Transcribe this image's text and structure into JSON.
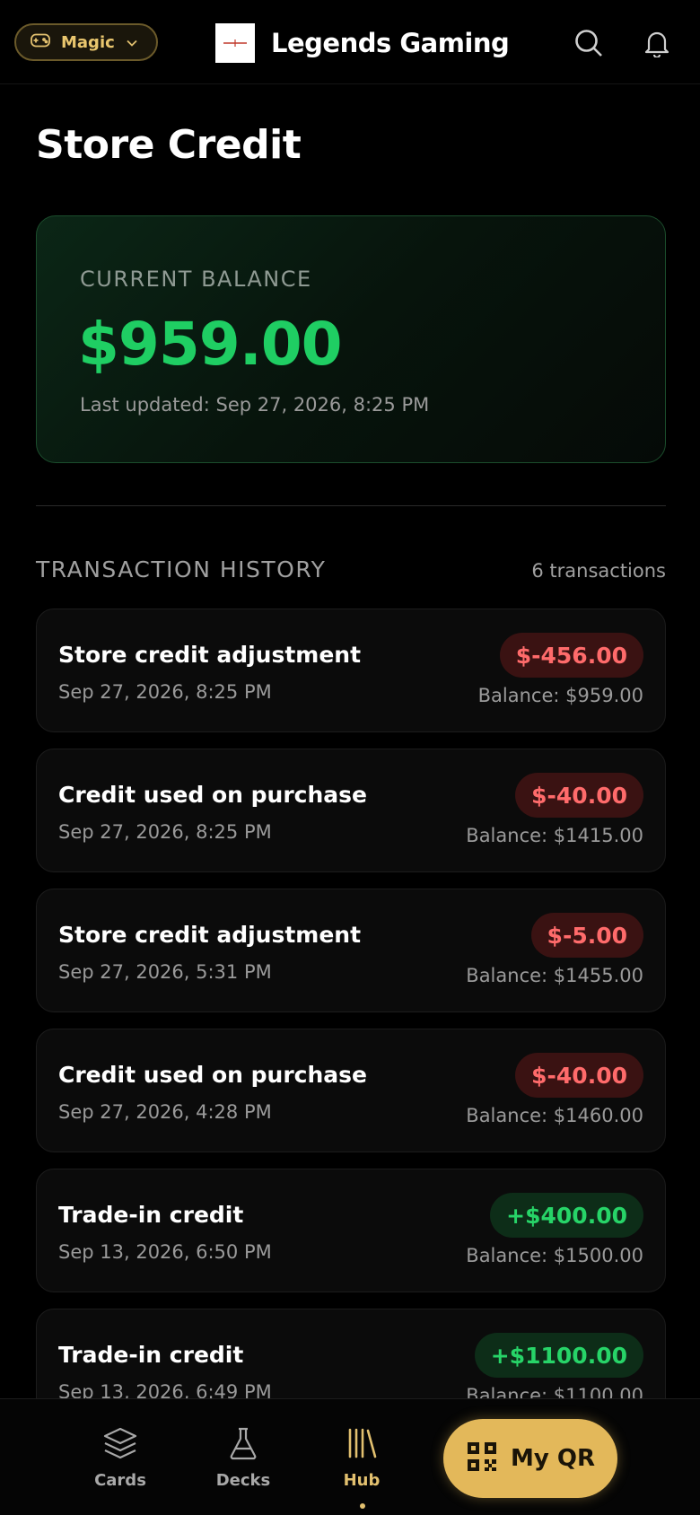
{
  "header": {
    "game_selector": "Magic",
    "brand_name": "Legends Gaming",
    "icons": [
      "controller-icon",
      "chevron-down-icon",
      "search-icon",
      "bell-icon"
    ]
  },
  "page": {
    "title": "Store Credit"
  },
  "balance": {
    "label": "CURRENT BALANCE",
    "amount": "$959.00",
    "updated": "Last updated: Sep 27, 2026, 8:25 PM"
  },
  "history": {
    "title": "TRANSACTION HISTORY",
    "count": "6 transactions",
    "transactions": [
      {
        "title": "Store credit adjustment",
        "date": "Sep 27, 2026, 8:25 PM",
        "amount": "$-456.00",
        "balance": "Balance: $959.00",
        "kind": "neg"
      },
      {
        "title": "Credit used on purchase",
        "date": "Sep 27, 2026, 8:25 PM",
        "amount": "$-40.00",
        "balance": "Balance: $1415.00",
        "kind": "neg"
      },
      {
        "title": "Store credit adjustment",
        "date": "Sep 27, 2026, 5:31 PM",
        "amount": "$-5.00",
        "balance": "Balance: $1455.00",
        "kind": "neg"
      },
      {
        "title": "Credit used on purchase",
        "date": "Sep 27, 2026, 4:28 PM",
        "amount": "$-40.00",
        "balance": "Balance: $1460.00",
        "kind": "neg"
      },
      {
        "title": "Trade-in credit",
        "date": "Sep 13, 2026, 6:50 PM",
        "amount": "+$400.00",
        "balance": "Balance: $1500.00",
        "kind": "pos"
      },
      {
        "title": "Trade-in credit",
        "date": "Sep 13, 2026, 6:49 PM",
        "amount": "+$1100.00",
        "balance": "Balance: $1100.00",
        "kind": "pos"
      }
    ]
  },
  "nav": {
    "cards": "Cards",
    "decks": "Decks",
    "hub": "Hub",
    "qr": "My QR",
    "active": "hub"
  },
  "colors": {
    "accent_gold": "#e3b85a",
    "positive": "#27d468",
    "negative": "#ff6b6b",
    "balance_green": "#1fce63"
  }
}
